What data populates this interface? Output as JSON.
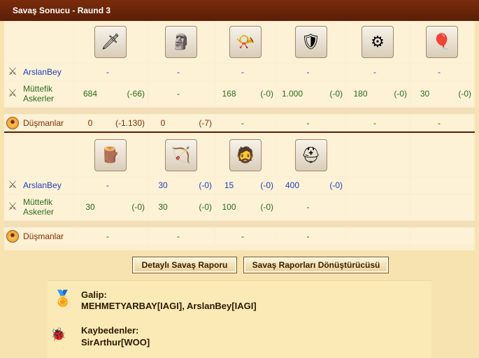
{
  "header": {
    "title": "Savaş Sonucu - Raund 3"
  },
  "rows_labels": {
    "player": "ArslanBey",
    "ally": "Müttefik Askerler",
    "enemy": "Düşmanlar"
  },
  "section1": {
    "units": [
      {
        "icon": "warrior-with-sword-icon",
        "glyph": "🗡"
      },
      {
        "icon": "stone-tower-icon",
        "glyph": "🗿"
      },
      {
        "icon": "horn-blower-icon",
        "glyph": "📯"
      },
      {
        "icon": "spartan-hoplite-icon",
        "glyph": "🛡"
      },
      {
        "icon": "catapult-machine-icon",
        "glyph": "⚙"
      },
      {
        "icon": "war-balloon-icon",
        "glyph": "🎈"
      }
    ],
    "player": [
      {
        "v": "-",
        "d": ""
      },
      {
        "v": "-",
        "d": ""
      },
      {
        "v": "-",
        "d": ""
      },
      {
        "v": "-",
        "d": ""
      },
      {
        "v": "-",
        "d": ""
      },
      {
        "v": "-",
        "d": ""
      }
    ],
    "ally": [
      {
        "v": "684",
        "d": "(-66)"
      },
      {
        "v": "-",
        "d": ""
      },
      {
        "v": "168",
        "d": "(-0)"
      },
      {
        "v": "1.000",
        "d": "(-0)"
      },
      {
        "v": "180",
        "d": "(-0)"
      },
      {
        "v": "30",
        "d": "(-0)"
      }
    ],
    "enemy": [
      {
        "v": "0",
        "d": "(-1.130)"
      },
      {
        "v": "0",
        "d": "(-7)"
      },
      {
        "v": "-",
        "d": ""
      },
      {
        "v": "-",
        "d": ""
      },
      {
        "v": "-",
        "d": ""
      },
      {
        "v": "-",
        "d": ""
      }
    ]
  },
  "section2": {
    "units": [
      {
        "icon": "battering-ram-icon",
        "glyph": "🪵"
      },
      {
        "icon": "siege-catapult-icon",
        "glyph": "🏹"
      },
      {
        "icon": "bearded-warrior-icon",
        "glyph": "🧔"
      },
      {
        "icon": "helmeted-soldier-icon",
        "glyph": "⛑"
      }
    ],
    "player": [
      {
        "v": "-",
        "d": ""
      },
      {
        "v": "30",
        "d": "(-0)"
      },
      {
        "v": "15",
        "d": "(-0)"
      },
      {
        "v": "400",
        "d": "(-0)"
      }
    ],
    "ally": [
      {
        "v": "30",
        "d": "(-0)"
      },
      {
        "v": "30",
        "d": "(-0)"
      },
      {
        "v": "100",
        "d": "(-0)"
      },
      {
        "v": "-",
        "d": ""
      }
    ],
    "enemy": [
      {
        "v": "-",
        "d": ""
      },
      {
        "v": "-",
        "d": ""
      },
      {
        "v": "-",
        "d": ""
      },
      {
        "v": "-",
        "d": ""
      }
    ]
  },
  "buttons": {
    "detail": "Detaylı Savaş Raporu",
    "converter": "Savaş Raporları Dönüştürücüsü"
  },
  "result": {
    "winner_label": "Galip:",
    "winners": "MEHMETYARBAY[IAGI], ArslanBey[IAGI]",
    "loser_label": "Kaybedenler:",
    "losers": "SirArthur[WOO]"
  },
  "colors": {
    "header": "#5a1e06",
    "player_text": "#1e3fbf",
    "ally_text": "#2b6e1e",
    "enemy_text": "#8a2a00"
  }
}
